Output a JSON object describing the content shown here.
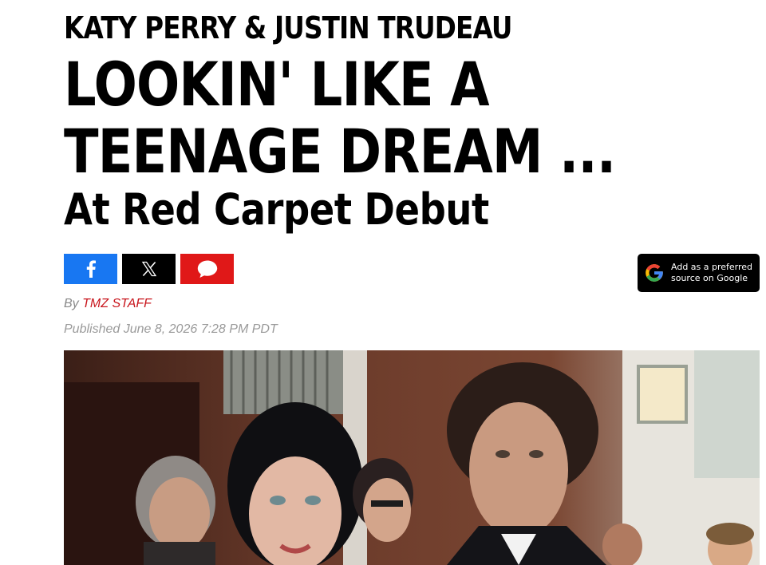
{
  "article": {
    "kicker": "KATY PERRY & JUSTIN TRUDEAU",
    "headline_line1": "LOOKIN' LIKE A",
    "headline_line2": "TEENAGE DREAM ...",
    "subheadline": "At Red Carpet Debut",
    "byline_prefix": "By",
    "author": "TMZ STAFF",
    "published": "Published June 8, 2026 7:28 PM PDT"
  },
  "share": {
    "facebook_icon": "facebook-icon",
    "x_icon": "x-icon",
    "comment_icon": "comment-bubble-icon",
    "colors": {
      "facebook": "#1877f2",
      "x": "#000000",
      "comment": "#e01818"
    }
  },
  "google_badge": {
    "line1": "Add as a preferred",
    "line2": "source on Google",
    "icon": "google-g-icon"
  },
  "hero_image": {
    "description_icon": "photo-icon"
  },
  "colors": {
    "author_link": "#c8161d",
    "meta_text": "#9a9a9a"
  }
}
